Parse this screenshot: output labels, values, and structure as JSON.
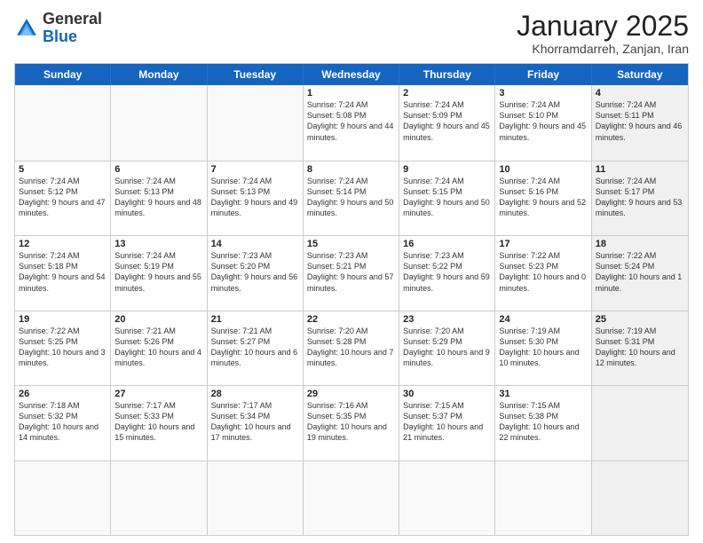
{
  "logo": {
    "general": "General",
    "blue": "Blue"
  },
  "header": {
    "month": "January 2025",
    "location": "Khorramdarreh, Zanjan, Iran"
  },
  "weekdays": [
    "Sunday",
    "Monday",
    "Tuesday",
    "Wednesday",
    "Thursday",
    "Friday",
    "Saturday"
  ],
  "rows": [
    [
      {
        "day": "",
        "info": "",
        "empty": true
      },
      {
        "day": "",
        "info": "",
        "empty": true
      },
      {
        "day": "",
        "info": "",
        "empty": true
      },
      {
        "day": "1",
        "info": "Sunrise: 7:24 AM\nSunset: 5:08 PM\nDaylight: 9 hours\nand 44 minutes."
      },
      {
        "day": "2",
        "info": "Sunrise: 7:24 AM\nSunset: 5:09 PM\nDaylight: 9 hours\nand 45 minutes."
      },
      {
        "day": "3",
        "info": "Sunrise: 7:24 AM\nSunset: 5:10 PM\nDaylight: 9 hours\nand 45 minutes."
      },
      {
        "day": "4",
        "info": "Sunrise: 7:24 AM\nSunset: 5:11 PM\nDaylight: 9 hours\nand 46 minutes.",
        "shaded": true
      }
    ],
    [
      {
        "day": "5",
        "info": "Sunrise: 7:24 AM\nSunset: 5:12 PM\nDaylight: 9 hours\nand 47 minutes."
      },
      {
        "day": "6",
        "info": "Sunrise: 7:24 AM\nSunset: 5:13 PM\nDaylight: 9 hours\nand 48 minutes."
      },
      {
        "day": "7",
        "info": "Sunrise: 7:24 AM\nSunset: 5:13 PM\nDaylight: 9 hours\nand 49 minutes."
      },
      {
        "day": "8",
        "info": "Sunrise: 7:24 AM\nSunset: 5:14 PM\nDaylight: 9 hours\nand 50 minutes."
      },
      {
        "day": "9",
        "info": "Sunrise: 7:24 AM\nSunset: 5:15 PM\nDaylight: 9 hours\nand 50 minutes."
      },
      {
        "day": "10",
        "info": "Sunrise: 7:24 AM\nSunset: 5:16 PM\nDaylight: 9 hours\nand 52 minutes."
      },
      {
        "day": "11",
        "info": "Sunrise: 7:24 AM\nSunset: 5:17 PM\nDaylight: 9 hours\nand 53 minutes.",
        "shaded": true
      }
    ],
    [
      {
        "day": "12",
        "info": "Sunrise: 7:24 AM\nSunset: 5:18 PM\nDaylight: 9 hours\nand 54 minutes."
      },
      {
        "day": "13",
        "info": "Sunrise: 7:24 AM\nSunset: 5:19 PM\nDaylight: 9 hours\nand 55 minutes."
      },
      {
        "day": "14",
        "info": "Sunrise: 7:23 AM\nSunset: 5:20 PM\nDaylight: 9 hours\nand 56 minutes."
      },
      {
        "day": "15",
        "info": "Sunrise: 7:23 AM\nSunset: 5:21 PM\nDaylight: 9 hours\nand 57 minutes."
      },
      {
        "day": "16",
        "info": "Sunrise: 7:23 AM\nSunset: 5:22 PM\nDaylight: 9 hours\nand 59 minutes."
      },
      {
        "day": "17",
        "info": "Sunrise: 7:22 AM\nSunset: 5:23 PM\nDaylight: 10 hours\nand 0 minutes."
      },
      {
        "day": "18",
        "info": "Sunrise: 7:22 AM\nSunset: 5:24 PM\nDaylight: 10 hours\nand 1 minute.",
        "shaded": true
      }
    ],
    [
      {
        "day": "19",
        "info": "Sunrise: 7:22 AM\nSunset: 5:25 PM\nDaylight: 10 hours\nand 3 minutes."
      },
      {
        "day": "20",
        "info": "Sunrise: 7:21 AM\nSunset: 5:26 PM\nDaylight: 10 hours\nand 4 minutes."
      },
      {
        "day": "21",
        "info": "Sunrise: 7:21 AM\nSunset: 5:27 PM\nDaylight: 10 hours\nand 6 minutes."
      },
      {
        "day": "22",
        "info": "Sunrise: 7:20 AM\nSunset: 5:28 PM\nDaylight: 10 hours\nand 7 minutes."
      },
      {
        "day": "23",
        "info": "Sunrise: 7:20 AM\nSunset: 5:29 PM\nDaylight: 10 hours\nand 9 minutes."
      },
      {
        "day": "24",
        "info": "Sunrise: 7:19 AM\nSunset: 5:30 PM\nDaylight: 10 hours\nand 10 minutes."
      },
      {
        "day": "25",
        "info": "Sunrise: 7:19 AM\nSunset: 5:31 PM\nDaylight: 10 hours\nand 12 minutes.",
        "shaded": true
      }
    ],
    [
      {
        "day": "26",
        "info": "Sunrise: 7:18 AM\nSunset: 5:32 PM\nDaylight: 10 hours\nand 14 minutes."
      },
      {
        "day": "27",
        "info": "Sunrise: 7:17 AM\nSunset: 5:33 PM\nDaylight: 10 hours\nand 15 minutes."
      },
      {
        "day": "28",
        "info": "Sunrise: 7:17 AM\nSunset: 5:34 PM\nDaylight: 10 hours\nand 17 minutes."
      },
      {
        "day": "29",
        "info": "Sunrise: 7:16 AM\nSunset: 5:35 PM\nDaylight: 10 hours\nand 19 minutes."
      },
      {
        "day": "30",
        "info": "Sunrise: 7:15 AM\nSunset: 5:37 PM\nDaylight: 10 hours\nand 21 minutes."
      },
      {
        "day": "31",
        "info": "Sunrise: 7:15 AM\nSunset: 5:38 PM\nDaylight: 10 hours\nand 22 minutes."
      },
      {
        "day": "",
        "info": "",
        "empty": true,
        "shaded": true
      }
    ],
    [
      {
        "day": "",
        "info": "",
        "empty": true
      },
      {
        "day": "",
        "info": "",
        "empty": true
      },
      {
        "day": "",
        "info": "",
        "empty": true
      },
      {
        "day": "",
        "info": "",
        "empty": true
      },
      {
        "day": "",
        "info": "",
        "empty": true
      },
      {
        "day": "",
        "info": "",
        "empty": true
      },
      {
        "day": "",
        "info": "",
        "empty": true,
        "shaded": true
      }
    ]
  ]
}
